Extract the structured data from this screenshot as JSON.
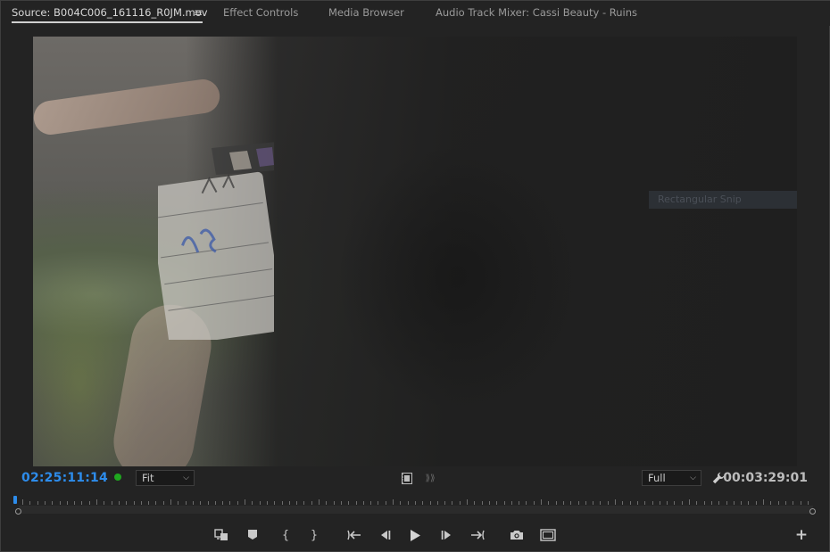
{
  "tabs": [
    {
      "label": "Source: B004C006_161116_R0JM.mov",
      "active": true
    },
    {
      "label": "Effect Controls",
      "active": false
    },
    {
      "label": "Media Browser",
      "active": false
    },
    {
      "label": "Audio Track Mixer: Cassi Beauty - Ruins",
      "active": false
    }
  ],
  "tab_menu_icon": "≡",
  "viewer": {
    "overlay_label": "Rectangular Snip"
  },
  "controls": {
    "timecode_in": "02:25:11:14",
    "zoom_value": "Fit",
    "resolution_value": "Full",
    "timecode_duration": "00:03:29:01",
    "accent_color": "#2d8ceb",
    "status_dot_color": "#1fa71f"
  },
  "transport": {
    "buttons": [
      {
        "name": "insert-overwrite-icon",
        "glyph": "⇄"
      },
      {
        "name": "add-marker-icon",
        "glyph": "⬟"
      },
      {
        "name": "mark-in-icon",
        "glyph": "{"
      },
      {
        "name": "mark-out-icon",
        "glyph": "}"
      },
      {
        "name": "go-to-in-icon",
        "glyph": "{←"
      },
      {
        "name": "step-back-icon",
        "glyph": "◂|"
      },
      {
        "name": "play-icon",
        "glyph": "▶"
      },
      {
        "name": "step-forward-icon",
        "glyph": "|▸"
      },
      {
        "name": "go-to-out-icon",
        "glyph": "→}"
      },
      {
        "name": "export-frame-icon",
        "glyph": "📷"
      },
      {
        "name": "safe-margins-icon",
        "glyph": "▭"
      }
    ],
    "add_button": "+"
  }
}
